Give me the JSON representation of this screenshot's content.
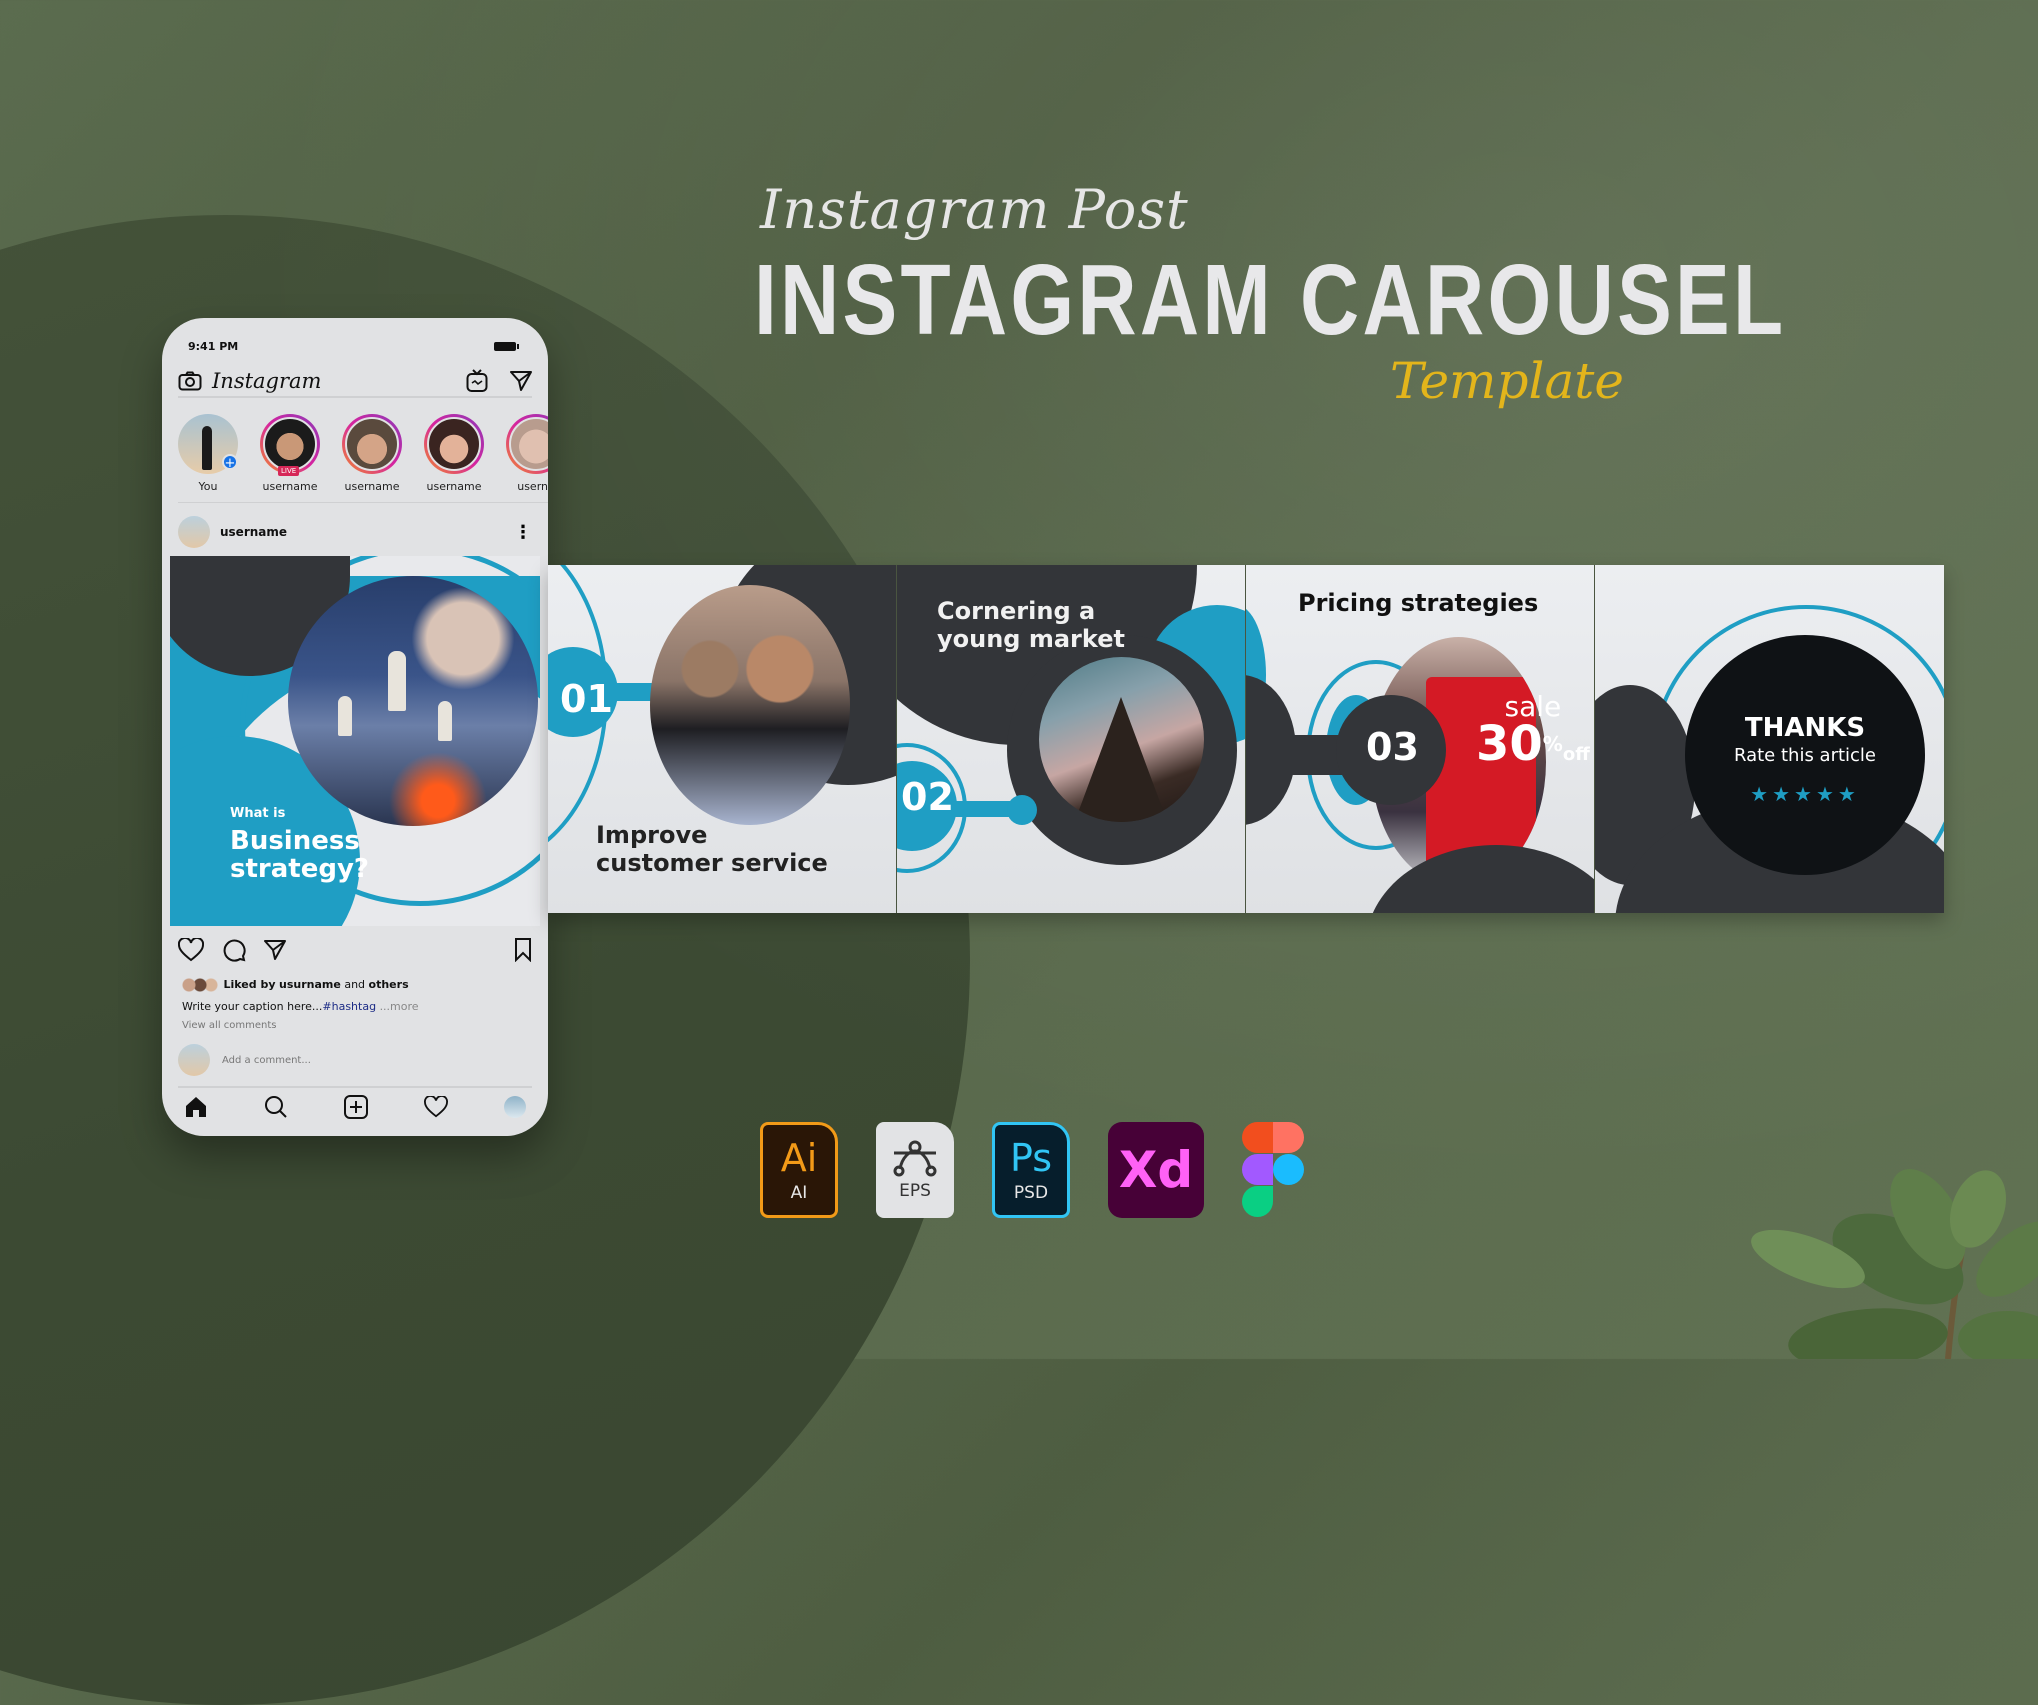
{
  "header": {
    "script_top": "Instagram Post",
    "title": "INSTAGRAM CAROUSEL",
    "script_bottom": "Template"
  },
  "phone": {
    "time": "9:41 PM",
    "app_name": "Instagram",
    "stories": [
      {
        "label": "You",
        "own": true
      },
      {
        "label": "username",
        "live": true,
        "live_label": "LIVE"
      },
      {
        "label": "username"
      },
      {
        "label": "username"
      },
      {
        "label": "userna"
      }
    ],
    "post": {
      "username": "username",
      "image": {
        "small": "What is",
        "big_line1": "Business",
        "big_line2": "strategy?"
      },
      "likes_prefix": "Liked by",
      "likes_user": "usurname",
      "likes_mid": "and",
      "likes_suffix": "others",
      "caption": "Write your caption here...",
      "hashtag": "#hashtag",
      "more": "...more",
      "view_all": "View all comments",
      "add_comment": "Add a comment..."
    }
  },
  "carousel": {
    "slides": [
      {
        "number": "01",
        "title_line1": "Improve",
        "title_line2": "customer service"
      },
      {
        "number": "02",
        "title_line1": "Cornering a",
        "title_line2": "young market"
      },
      {
        "number": "03",
        "title": "Pricing strategies",
        "sale_word": "sale",
        "sale_value": "30",
        "sale_unit": "%",
        "sale_off": "off"
      },
      {
        "thanks": "THANKS",
        "rate": "Rate this article",
        "stars": "★★★★★",
        "rating": 5
      }
    ]
  },
  "formats": [
    {
      "name": "ai",
      "glyph": "Ai",
      "label": "AI",
      "color": "#f29a18"
    },
    {
      "name": "eps",
      "label": "EPS",
      "color": "#333333"
    },
    {
      "name": "psd",
      "glyph": "Ps",
      "label": "PSD",
      "color": "#31c5f4"
    },
    {
      "name": "xd",
      "glyph": "Xd",
      "color": "#ff61f6"
    },
    {
      "name": "figma"
    }
  ],
  "colors": {
    "teal": "#1f9ec4",
    "dark": "#333539",
    "gold": "#e3b51b",
    "background": "#56664a"
  }
}
